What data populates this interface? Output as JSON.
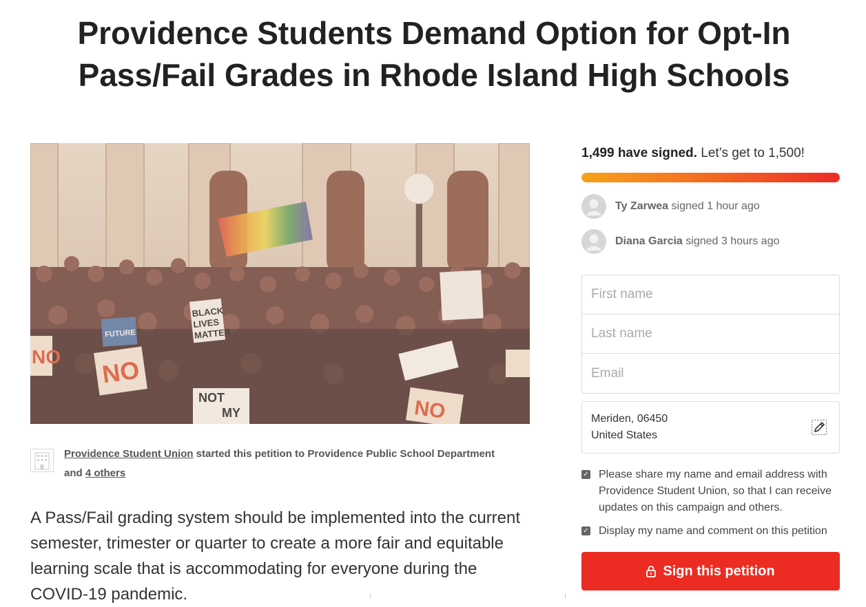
{
  "petition": {
    "title_line1": "Providence Students Demand Option for Opt-In",
    "title_line2": "Pass/Fail Grades in Rhode Island High Schools",
    "starter": {
      "org_name": "Providence Student Union",
      "middle_text": " started this petition to Providence Public School Department ",
      "and_text": "and ",
      "others_link": "4 others"
    },
    "summary": "A Pass/Fail grading system should be implemented into the current semester, trimester or quarter to create a more fair and equitable learning scale that is accommodating for everyone during the COVID-19 pandemic.",
    "hero_signs": [
      "BLACK",
      "LIVES",
      "MATTER",
      "NO",
      "NOT",
      "MY",
      "FUTURE",
      "NO",
      "NO"
    ]
  },
  "sidebar": {
    "signed_count": "1,499 have signed.",
    "goal_text": " Let’s get to 1,500!",
    "progress_fraction": 0.999,
    "accent_color": "#ec2c22",
    "recent_signers": [
      {
        "name": "Ty Zarwea",
        "action": " signed 1 hour ago"
      },
      {
        "name": "Diana Garcia",
        "action": " signed 3 hours ago"
      }
    ],
    "form": {
      "first_name_placeholder": "First name",
      "last_name_placeholder": "Last name",
      "email_placeholder": "Email",
      "location_line1": "Meriden, 06450",
      "location_line2": "United States",
      "checkbox_share_label": "Please share my name and email address with Providence Student Union, so that I can receive updates on this campaign and others.",
      "checkbox_share_checked": true,
      "checkbox_display_label": "Display my name and comment on this petition",
      "checkbox_display_checked": true,
      "submit_label": "Sign this petition"
    }
  }
}
